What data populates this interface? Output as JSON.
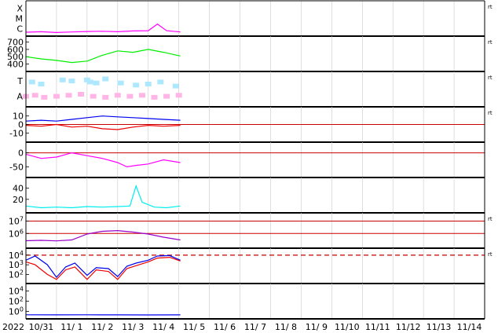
{
  "x_axis": {
    "year_label": "2022",
    "date_labels": [
      "10/31",
      "11/ 1",
      "11/ 2",
      "11/ 3",
      "11/ 4",
      "11/ 5",
      "11/ 6",
      "11/ 7",
      "11/ 8",
      "11/ 9",
      "11/10",
      "11/11",
      "11/12",
      "11/13",
      "11/14"
    ]
  },
  "edge_tag": "rt",
  "colors": {
    "magenta": "#ff00ff",
    "green": "#00ee00",
    "lightblue": "#aee8ff",
    "pink": "#ffb6e6",
    "blue": "#0000ee",
    "red": "#ee0000",
    "cyan": "#00eeee",
    "purple": "#9900cc",
    "reference_line": "#cc0000",
    "grid": "#c8c8c8"
  },
  "chart_data": [
    {
      "id": "xray-class",
      "type": "line",
      "title": "",
      "y_categories": [
        "C",
        "M",
        "X"
      ],
      "ylim": [
        0,
        3
      ],
      "data_end_day": 5.05,
      "series": [
        {
          "color_key": "magenta",
          "x": [
            0,
            0.5,
            1,
            1.5,
            2,
            2.5,
            3,
            3.5,
            4,
            4.3,
            4.6,
            5.05
          ],
          "values": [
            0.15,
            0.2,
            0.12,
            0.18,
            0.22,
            0.25,
            0.2,
            0.28,
            0.3,
            0.95,
            0.3,
            0.18
          ]
        }
      ]
    },
    {
      "id": "solar-wind-speed",
      "type": "line",
      "title": "",
      "yticks": [
        400,
        500,
        600,
        700
      ],
      "ylim": [
        330,
        750
      ],
      "data_end_day": 5.05,
      "series": [
        {
          "color_key": "green",
          "x": [
            0,
            0.5,
            1,
            1.5,
            2,
            2.5,
            3,
            3.5,
            4,
            4.5,
            5.05
          ],
          "values": [
            500,
            470,
            450,
            420,
            440,
            520,
            580,
            560,
            600,
            560,
            510
          ]
        }
      ]
    },
    {
      "id": "imf-sector",
      "type": "scatter",
      "title": "",
      "y_categories": [
        "A",
        "T"
      ],
      "ylim": [
        0,
        3
      ],
      "data_end_day": 5.05,
      "series": [
        {
          "color_key": "lightblue",
          "band": "T",
          "x": [
            0.2,
            0.5,
            1.2,
            1.5,
            2,
            2.1,
            2.3,
            2.6,
            3.1,
            3.6,
            4.0,
            4.4,
            4.9
          ],
          "values": [
            2.2,
            2.0,
            2.4,
            2.3,
            2.4,
            2.2,
            2.1,
            2.5,
            2.1,
            1.9,
            2.0,
            2.2,
            1.8
          ]
        },
        {
          "color_key": "pink",
          "band": "A",
          "x": [
            0,
            0.3,
            0.6,
            1.0,
            1.4,
            1.8,
            2.2,
            2.6,
            3.0,
            3.4,
            3.8,
            4.2,
            4.6,
            5.0
          ],
          "values": [
            0.8,
            0.9,
            0.7,
            0.8,
            0.9,
            1.0,
            0.8,
            0.7,
            0.9,
            0.8,
            0.9,
            0.7,
            0.8,
            0.9
          ]
        }
      ]
    },
    {
      "id": "imf-bz-bt",
      "type": "line",
      "title": "",
      "yticks": [
        -10,
        0,
        10
      ],
      "ylim": [
        -18,
        18
      ],
      "reference": 0,
      "data_end_day": 5.05,
      "series": [
        {
          "color_key": "blue",
          "x": [
            0,
            0.5,
            1,
            1.5,
            2,
            2.5,
            3,
            3.5,
            4,
            4.5,
            5.05
          ],
          "values": [
            4,
            5,
            4,
            6,
            8,
            10,
            9,
            8,
            7,
            6,
            5
          ]
        },
        {
          "color_key": "red",
          "x": [
            0,
            0.5,
            1,
            1.5,
            2,
            2.5,
            3,
            3.5,
            4,
            4.5,
            5.05
          ],
          "values": [
            -1,
            -2,
            0,
            -3,
            -2,
            -5,
            -6,
            -3,
            -1,
            -2,
            -1
          ]
        }
      ]
    },
    {
      "id": "dst-index",
      "type": "line",
      "title": "",
      "yticks": [
        -50,
        0
      ],
      "ylim": [
        -80,
        30
      ],
      "reference": 0,
      "data_end_day": 5.05,
      "series": [
        {
          "color_key": "magenta",
          "x": [
            0,
            0.5,
            1,
            1.5,
            2,
            2.5,
            3,
            3.3,
            3.6,
            4,
            4.5,
            5.05
          ],
          "values": [
            -5,
            -20,
            -15,
            0,
            -10,
            -20,
            -35,
            -50,
            -45,
            -40,
            -25,
            -35
          ]
        }
      ]
    },
    {
      "id": "kp-like",
      "type": "line",
      "title": "",
      "yticks": [
        20,
        40
      ],
      "ylim": [
        0,
        55
      ],
      "data_end_day": 5.05,
      "series": [
        {
          "color_key": "cyan",
          "x": [
            0,
            0.5,
            1,
            1.5,
            2,
            2.5,
            3,
            3.4,
            3.6,
            3.8,
            4.2,
            4.6,
            5.05
          ],
          "values": [
            8,
            5,
            6,
            5,
            7,
            6,
            7,
            8,
            44,
            15,
            6,
            5,
            8
          ]
        }
      ]
    },
    {
      "id": "electron-flux",
      "type": "line",
      "title": "",
      "yscale": "log",
      "yticks": [
        1000000,
        10000000
      ],
      "ylim": [
        100000,
        30000000
      ],
      "references": [
        1000000,
        10000000
      ],
      "data_end_day": 5.05,
      "series": [
        {
          "color_key": "purple",
          "x": [
            0,
            0.5,
            1,
            1.5,
            2,
            2.5,
            3,
            3.5,
            4,
            4.5,
            5.05
          ],
          "values": [
            260000,
            280000,
            250000,
            300000,
            900000,
            1500000,
            1700000,
            1300000,
            900000,
            500000,
            300000
          ]
        }
      ]
    },
    {
      "id": "proton-flux",
      "type": "line",
      "title": "",
      "yscale": "log",
      "yticks": [
        100,
        1000,
        10000
      ],
      "ylim": [
        20,
        30000
      ],
      "dashed_reference": 10000,
      "data_end_day": 5.05,
      "series": [
        {
          "color_key": "blue",
          "x": [
            0,
            0.3,
            0.7,
            1.0,
            1.3,
            1.6,
            2.0,
            2.3,
            2.7,
            3.0,
            3.3,
            3.6,
            4.0,
            4.3,
            4.7,
            5.05
          ],
          "values": [
            3000,
            8000,
            1000,
            50,
            600,
            1500,
            80,
            500,
            400,
            60,
            700,
            1500,
            3000,
            8000,
            9000,
            3000
          ]
        },
        {
          "color_key": "red",
          "x": [
            0,
            0.3,
            0.7,
            1.0,
            1.3,
            1.6,
            2.0,
            2.3,
            2.7,
            3.0,
            3.3,
            3.6,
            4.0,
            4.3,
            4.7,
            5.05
          ],
          "values": [
            2000,
            1000,
            100,
            30,
            300,
            600,
            30,
            300,
            200,
            30,
            400,
            800,
            2000,
            5000,
            6000,
            2500
          ]
        }
      ]
    },
    {
      "id": "high-energy-proton",
      "type": "line",
      "title": "",
      "yscale": "log",
      "yticks": [
        1,
        100,
        10000
      ],
      "yticklabels": [
        "10^0",
        "10^2",
        "10^4"
      ],
      "ylim": [
        0.1,
        100000
      ],
      "data_end_day": 5.05,
      "series": [
        {
          "color_key": "blue",
          "x": [
            0,
            1,
            2,
            3,
            4,
            5.05
          ],
          "values": [
            0.22,
            0.21,
            0.22,
            0.21,
            0.2,
            0.21
          ]
        }
      ]
    }
  ]
}
